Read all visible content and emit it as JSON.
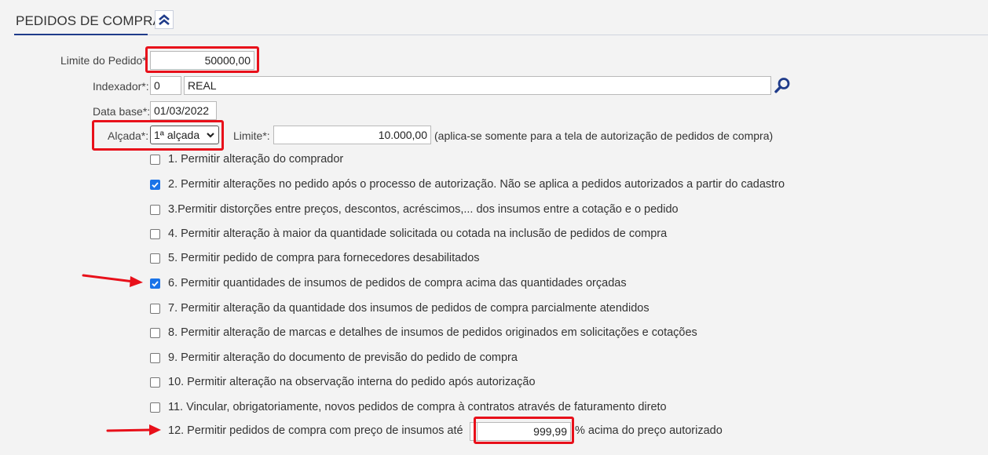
{
  "section": {
    "title": "PEDIDOS DE COMPRA",
    "collapse_icon": "double-chevron-up-icon"
  },
  "limite_pedido": {
    "label": "Limite do Pedido*",
    "value": "50000,00"
  },
  "indexador": {
    "label": "Indexador*:",
    "code": "0",
    "name": "REAL",
    "search_icon": "magnifier-icon"
  },
  "data_base": {
    "label": "Data base*:",
    "value": "01/03/2022"
  },
  "alcada": {
    "label": "Alçada*:",
    "selected": "1ª alçada"
  },
  "limite": {
    "label": "Limite*:",
    "value": "10.000,00",
    "note": "(aplica-se somente para a tela de autorização de pedidos de compra)"
  },
  "options": [
    {
      "text": "1. Permitir alteração do comprador",
      "checked": false
    },
    {
      "text": "2. Permitir alterações no pedido após o processo de autorização. Não se aplica a pedidos autorizados a partir do cadastro",
      "checked": true
    },
    {
      "text": "3.Permitir distorções entre preços, descontos, acréscimos,... dos insumos entre a cotação e o pedido",
      "checked": false
    },
    {
      "text": "4. Permitir alteração à maior da quantidade solicitada ou cotada na inclusão de pedidos de compra",
      "checked": false
    },
    {
      "text": "5. Permitir pedido de compra para fornecedores desabilitados",
      "checked": false
    },
    {
      "text": "6. Permitir quantidades de insumos de pedidos de compra acima das quantidades orçadas",
      "checked": true
    },
    {
      "text": "7. Permitir alteração da quantidade dos insumos de pedidos de compra parcialmente atendidos",
      "checked": false
    },
    {
      "text": "8. Permitir alteração de marcas e detalhes de insumos de pedidos originados em solicitações e cotações",
      "checked": false
    },
    {
      "text": "9. Permitir alteração do documento de previsão do pedido de compra",
      "checked": false
    },
    {
      "text": "10. Permitir alteração na observação interna do pedido após autorização",
      "checked": false
    },
    {
      "text": "11. Vincular, obrigatoriamente, novos pedidos de compra à contratos através de faturamento direto",
      "checked": false
    }
  ],
  "option12": {
    "prefix": "12. Permitir pedidos de compra com preço de insumos até",
    "value": "999,99",
    "suffix": "% acima do preço autorizado"
  },
  "colors": {
    "accent": "#1f3b8a",
    "highlight": "#e8101a",
    "checkbox": "#1a73e8"
  }
}
